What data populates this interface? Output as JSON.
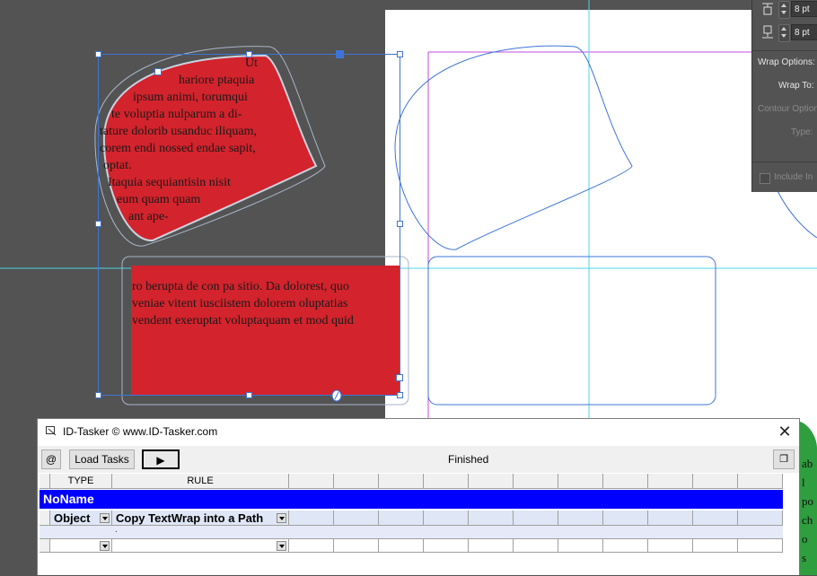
{
  "layout_text": {
    "frame1_lines": [
      "Ut",
      "hariore ptaquia",
      "ipsum animi, torumqui",
      "te voluptia nulparum a di-",
      "tature dolorib usanduc iliquam,",
      "corem endi nossed endae sapit,",
      "optat.",
      "Itaquia sequiantisin nisit",
      "eum quam quam",
      "ant ape-"
    ],
    "frame2_lines": [
      "ro berupta de con pa sitio. Da dolorest, quo",
      "veniae vitent iusciistem dolorem oluptatias",
      "vendent exeruptat voluptaquam et mod quid"
    ]
  },
  "wrap_panel": {
    "top_offset": "8 pt",
    "bottom_offset": "8 pt",
    "wrap_options_label": "Wrap Options:",
    "wrap_to_label": "Wrap To:",
    "contour_options_label": "Contour Option",
    "type_label": "Type:",
    "include_label": "Include In"
  },
  "tasker": {
    "title": "ID-Tasker  © www.ID-Tasker.com",
    "load_tasks_label": "Load Tasks",
    "at_label": "@",
    "run_label": "▶",
    "status": "Finished",
    "columns": [
      "TYPE",
      "RULE"
    ],
    "group_name": "NoName",
    "rows": [
      {
        "type": "Object",
        "rule": "Copy TextWrap into a Path"
      },
      {
        "type": "",
        "rule": ""
      }
    ],
    "note_marker": "."
  },
  "right_edge_text": [
    "ab",
    "l",
    "po",
    "ch",
    "o",
    "s",
    "po"
  ],
  "colors": {
    "pasteboard": "#535353",
    "page": "#ffffff",
    "frame_fill": "#d3232c",
    "guide_cyan": "#4cd6e6",
    "margin_magenta": "#c04bdc",
    "selection_blue": "#3e74d8",
    "group_bar": "#0000ff"
  }
}
